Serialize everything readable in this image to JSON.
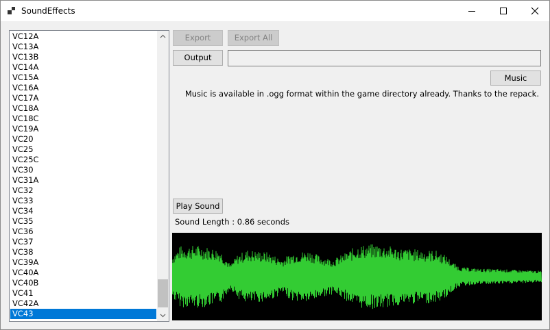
{
  "window": {
    "title": "SoundEffects"
  },
  "sound_list": {
    "items": [
      "VC12A",
      "VC13A",
      "VC13B",
      "VC14A",
      "VC15A",
      "VC16A",
      "VC17A",
      "VC18A",
      "VC18C",
      "VC19A",
      "VC20",
      "VC25",
      "VC25C",
      "VC30",
      "VC31A",
      "VC32",
      "VC33",
      "VC34",
      "VC35",
      "VC36",
      "VC37",
      "VC38",
      "VC39A",
      "VC40A",
      "VC40B",
      "VC41",
      "VC42A",
      "VC43"
    ],
    "selected": "VC43"
  },
  "toolbar": {
    "export_label": "Export",
    "export_all_label": "Export All",
    "output_label": "Output",
    "output_path": "",
    "music_label": "Music"
  },
  "music_note": "Music is available in .ogg format within the game directory already. Thanks to the repack.",
  "player": {
    "play_label": "Play Sound",
    "length_text": "Sound Length : 0.86 seconds"
  },
  "colors": {
    "waveform": "#33cc33",
    "waveform_bg": "#000000",
    "selection": "#0078d7"
  }
}
